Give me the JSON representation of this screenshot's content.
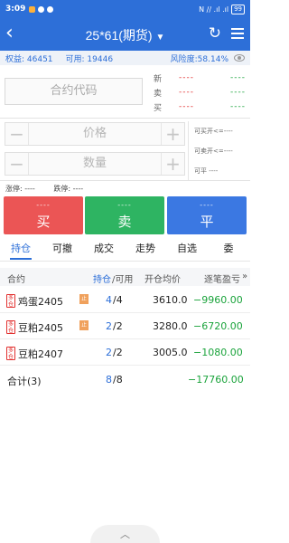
{
  "status_bar": {
    "time": "3:09",
    "icons": [
      "orange-app-icon",
      "weibo-icon",
      "eye-icon"
    ],
    "right": "N ∕∕ .ıl .ıl",
    "battery": "99"
  },
  "nav": {
    "title": "25*61(期货)",
    "caret": "▼",
    "back": "‹",
    "refresh": "↻"
  },
  "info": {
    "equity_label": "权益: 46451",
    "available_label": "可用: 19446",
    "risk_label": "风险度:58.14%"
  },
  "contract": {
    "placeholder": "合约代码"
  },
  "quotes": {
    "rows": [
      {
        "label": "新",
        "v1": "----",
        "v2": "----"
      },
      {
        "label": "卖",
        "v1": "----",
        "v2": "----"
      },
      {
        "label": "买",
        "v1": "----",
        "v2": "----"
      }
    ]
  },
  "order": {
    "price_placeholder": "价格",
    "qty_placeholder": "数量",
    "can_buy_open": "可买开<=----",
    "can_sell_open": "可卖开<=----",
    "can_close": "可平  ----",
    "limit_up": "涨停: ----",
    "limit_down": "跌停: ----"
  },
  "buttons": {
    "buy": {
      "sub": "----",
      "label": "买"
    },
    "sell": {
      "sub": "----",
      "label": "卖"
    },
    "close": {
      "sub": "----",
      "label": "平"
    }
  },
  "tabs": [
    "持仓",
    "可撤",
    "成交",
    "走势",
    "自选",
    "委"
  ],
  "table": {
    "headers": {
      "contract": "合约",
      "position": "持仓",
      "available": "/可用",
      "open_avg": "开仓均价",
      "pnl": "逐笔盈亏",
      "more": "»"
    },
    "rows": [
      {
        "tag": "多仓",
        "ztag": "止",
        "name": "鸡蛋2405",
        "pos": "4",
        "avail": "/4",
        "avg": "3610.0",
        "pnl": "−9960.00"
      },
      {
        "tag": "多仓",
        "ztag": "止",
        "name": "豆粕2405",
        "pos": "2",
        "avail": "/2",
        "avg": "3280.0",
        "pnl": "−6720.00"
      },
      {
        "tag": "多仓",
        "ztag": "",
        "name": "豆粕2407",
        "pos": "2",
        "avail": "/2",
        "avg": "3005.0",
        "pnl": "−1080.00"
      }
    ],
    "total": {
      "label": "合计(3)",
      "pos": "8",
      "avail": "/8",
      "pnl": "−17760.00"
    }
  },
  "colors": {
    "primary": "#2d6fd8",
    "buy": "#eb5555",
    "sell": "#2eb462",
    "close": "#3b78e2",
    "loss": "#1aa33b"
  }
}
